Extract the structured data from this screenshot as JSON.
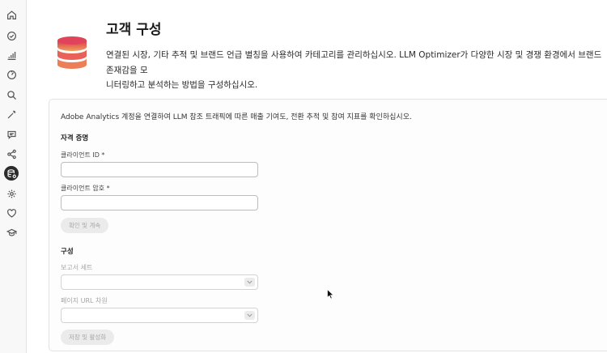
{
  "sidebar": {
    "items": [
      {
        "icon": "home-icon"
      },
      {
        "icon": "check-circle-icon"
      },
      {
        "icon": "bar-chart-icon"
      },
      {
        "icon": "gauge-icon"
      },
      {
        "icon": "search-icon"
      },
      {
        "icon": "magic-wand-icon"
      },
      {
        "icon": "chat-icon"
      },
      {
        "icon": "share-icon"
      },
      {
        "icon": "database-settings-icon",
        "active": true
      },
      {
        "icon": "gear-icon"
      },
      {
        "icon": "heart-icon"
      },
      {
        "icon": "graduation-cap-icon"
      }
    ]
  },
  "header": {
    "title": "고객 구성",
    "description_line1": "연결된 시장, 기타 추적 및 브랜드 언급 별칭을 사용하여 카테고리를 관리하십시오. LLM Optimizer가 다양한 시장 및 경쟁 환경에서 브랜드 존재감을 모",
    "description_line2": "니터링하고 분석하는 방법을 구성하십시오."
  },
  "card": {
    "intro": "Adobe Analytics 계정을 연결하여 LLM 참조 트래픽에 따른 매출 기여도, 전환 추적 및 참여 지표를 확인하십시오.",
    "credentials": {
      "heading": "자격 증명",
      "client_id_label": "클라이언트 ID *",
      "client_id_value": "",
      "client_secret_label": "클라이언트 암호 *",
      "client_secret_value": "",
      "confirm_button": "확인 및 계속"
    },
    "configuration": {
      "heading": "구성",
      "report_suite_label": "보고서 세트",
      "report_suite_value": "",
      "page_url_dimension_label": "페이지 URL 차원",
      "page_url_dimension_value": "",
      "save_button": "저장 및 활성화"
    }
  },
  "colors": {
    "accent_dark": "#2c2c2c",
    "logo_top": "#d9394f",
    "logo_bottom": "#f0a05a"
  }
}
